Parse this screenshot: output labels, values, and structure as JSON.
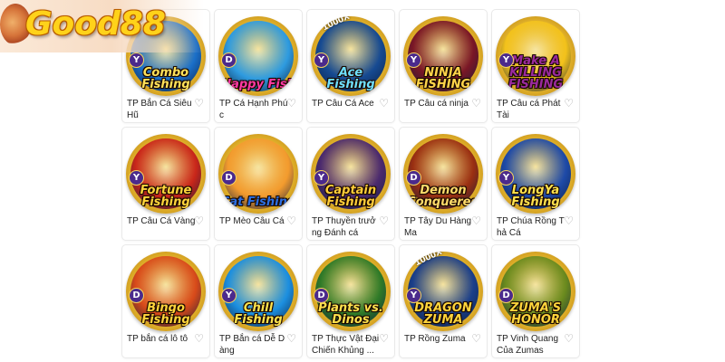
{
  "brand": {
    "logo_text": "Good88"
  },
  "favorite_icon": "heart-outline-icon",
  "games": [
    {
      "title": "TP Bắn Cá Siêu Hũ",
      "art_text": "Combo Fishing",
      "badge": "Y",
      "top_badge": "",
      "art_bg": "#1a6fc9",
      "art_fg": "#ffe25a"
    },
    {
      "title": "TP Cá Hạnh Phúc",
      "art_text": "Happy Fish",
      "badge": "D",
      "top_badge": "",
      "art_bg": "#2e9be0",
      "art_fg": "#ff3aa3"
    },
    {
      "title": "TP Câu Cá Ace",
      "art_text": "Ace Fishing",
      "badge": "Y",
      "top_badge": "1000X",
      "art_bg": "#164a92",
      "art_fg": "#6fe0ff"
    },
    {
      "title": "TP Câu cá ninja",
      "art_text": "NINJA FISHING",
      "badge": "Y",
      "top_badge": "",
      "art_bg": "#7a1726",
      "art_fg": "#ffd54a"
    },
    {
      "title": "TP Câu cá Phát Tài",
      "art_text": "Make A KILLING FISHING",
      "badge": "Y",
      "top_badge": "",
      "art_bg": "#f3c21b",
      "art_fg": "#9a2a9d"
    },
    {
      "title": "TP Câu Cá Vàng",
      "art_text": "Fortune Fishing",
      "badge": "Y",
      "top_badge": "",
      "art_bg": "#c9261a",
      "art_fg": "#ffd43b"
    },
    {
      "title": "TP Mèo Câu Cá",
      "art_text": "Cat Fishing",
      "badge": "D",
      "top_badge": "",
      "art_bg": "#f39b2e",
      "art_fg": "#2d6fe2"
    },
    {
      "title": "TP Thuyền trưởng Đánh cá",
      "art_text": "Captain Fishing",
      "badge": "Y",
      "top_badge": "",
      "art_bg": "#4b2a6e",
      "art_fg": "#ffcd3a"
    },
    {
      "title": "TP Tây Du Hàng Ma",
      "art_text": "Demon Conquered",
      "badge": "D",
      "top_badge": "",
      "art_bg": "#9a2f12",
      "art_fg": "#ffdb6a"
    },
    {
      "title": "TP Chúa Rồng Thả Cá",
      "art_text": "LongYa Fishing",
      "badge": "Y",
      "top_badge": "",
      "art_bg": "#1e4aa8",
      "art_fg": "#ffe14d"
    },
    {
      "title": "TP bắn cá lô tô",
      "art_text": "Bingo Fishing",
      "badge": "D",
      "top_badge": "",
      "art_bg": "#d84a1a",
      "art_fg": "#ffd43b"
    },
    {
      "title": "TP Bắn cá Dễ Dàng",
      "art_text": "Chill Fishing",
      "badge": "Y",
      "top_badge": "",
      "art_bg": "#1c8fe0",
      "art_fg": "#ffe44d"
    },
    {
      "title": "TP Thực Vật Đại Chiến Khủng ...",
      "art_text": "Plants vs. Dinos",
      "badge": "D",
      "top_badge": "",
      "art_bg": "#2f7a28",
      "art_fg": "#ffe14d"
    },
    {
      "title": "TP Rồng Zuma",
      "art_text": "DRAGON ZUMA",
      "badge": "Y",
      "top_badge": "1000X",
      "art_bg": "#1b3f8a",
      "art_fg": "#ffd43b"
    },
    {
      "title": "TP Vinh Quang Của Zumas",
      "art_text": "ZUMA'S HONOR",
      "badge": "D",
      "top_badge": "",
      "art_bg": "#6a8a1e",
      "art_fg": "#ffd43b"
    }
  ]
}
